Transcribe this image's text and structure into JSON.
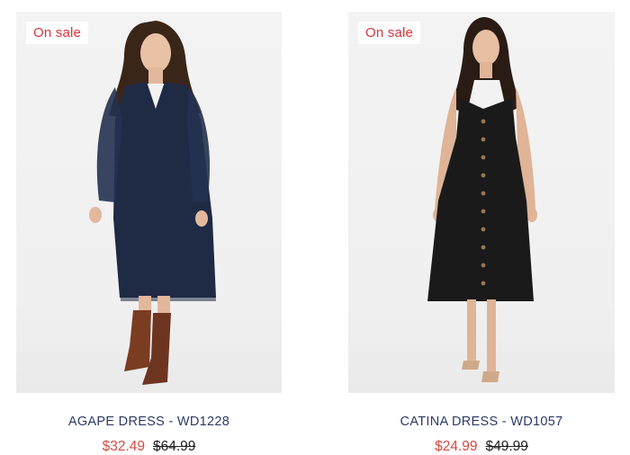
{
  "products": [
    {
      "badge": "On sale",
      "name": "AGAPE DRESS - WD1228",
      "sale_price": "$32.49",
      "original_price": "$64.99",
      "dress_color": "#1f2a45"
    },
    {
      "badge": "On sale",
      "name": "CATINA DRESS - WD1057",
      "sale_price": "$24.99",
      "original_price": "$49.99",
      "dress_color": "#1a1a1a"
    }
  ],
  "colors": {
    "sale_red": "#d8343a",
    "title_navy": "#2b3a67"
  }
}
